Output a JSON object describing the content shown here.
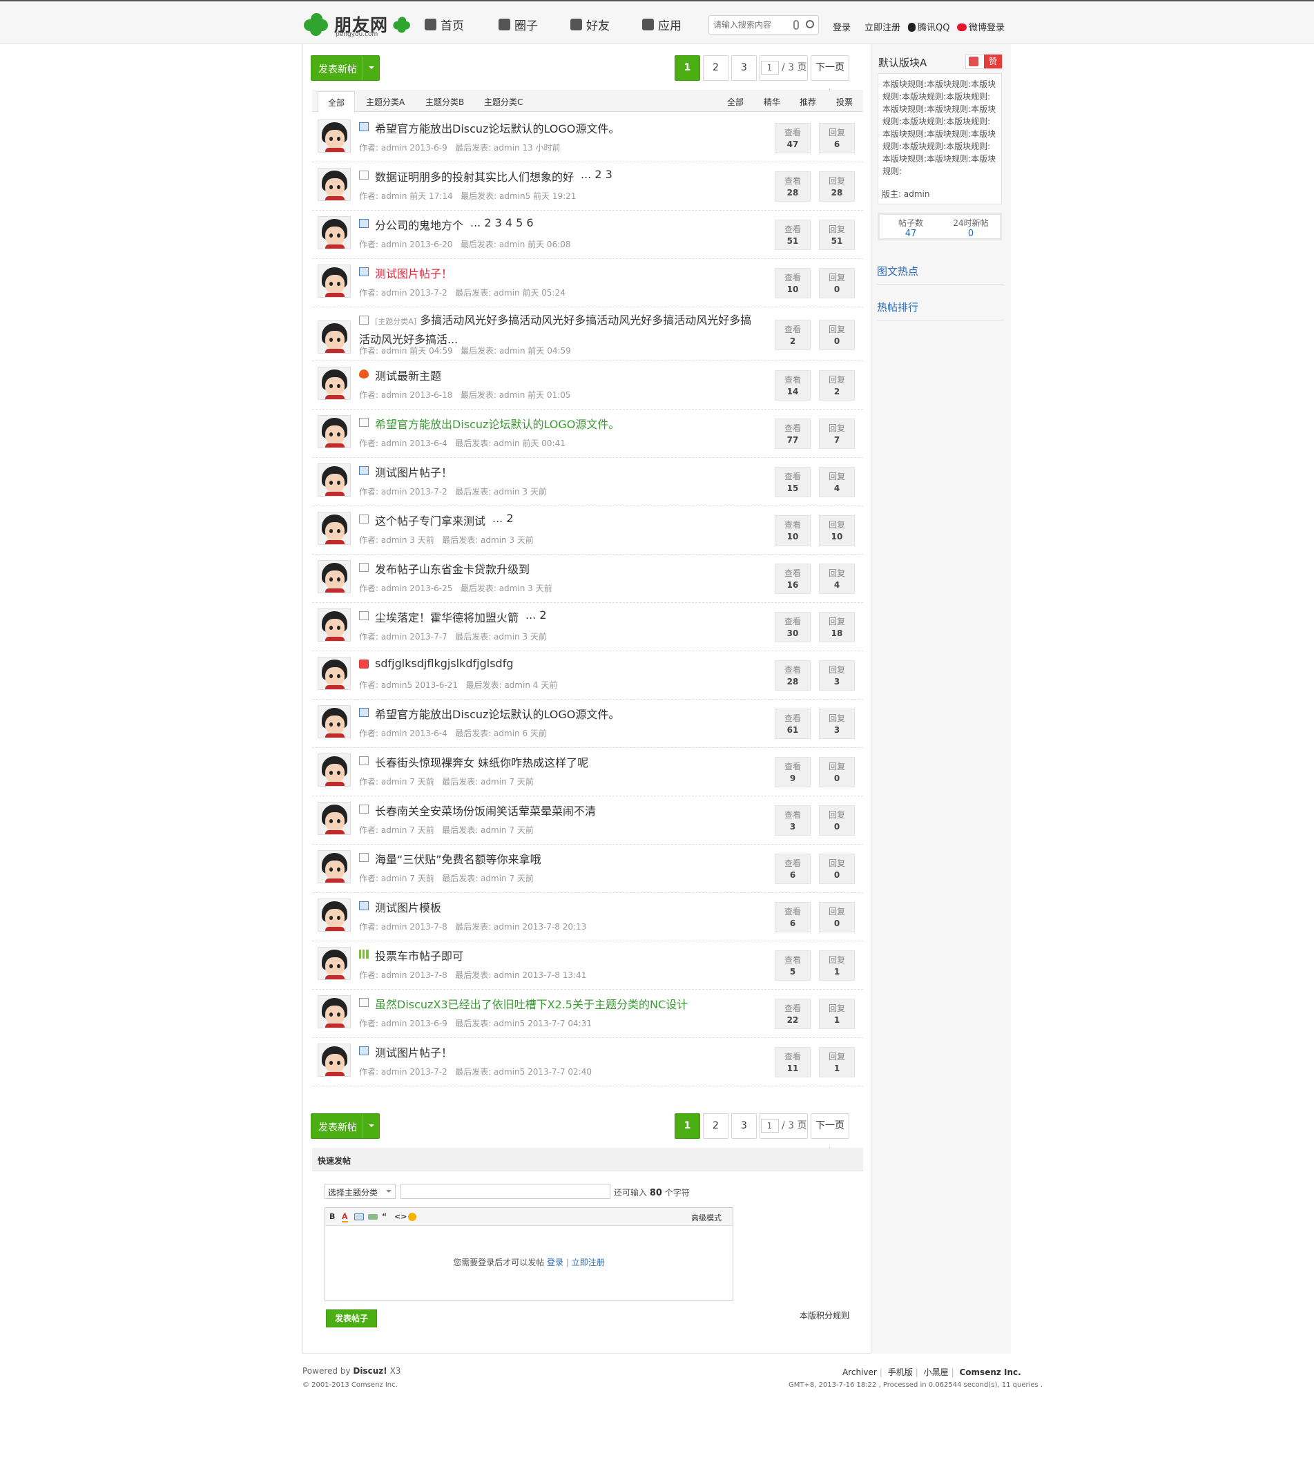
{
  "header": {
    "logo_text": "朋友网",
    "logo_sub": "pengyou.com",
    "nav": [
      "首页",
      "圈子",
      "好友",
      "应用"
    ],
    "search_placeholder": "请输入搜索内容",
    "links": [
      "登录",
      "立即注册",
      "腾讯QQ",
      "微博登录"
    ]
  },
  "toolbar": {
    "post_button": "发表新帖",
    "pages": [
      "1",
      "2",
      "3"
    ],
    "page_input": "1",
    "page_total": "/ 3 页",
    "next": "下一页"
  },
  "filters": {
    "left": [
      "全部",
      "主题分类A",
      "主题分类B",
      "主题分类C"
    ],
    "right": [
      "全部",
      "精华",
      "推荐",
      "投票"
    ]
  },
  "count_labels": {
    "views": "查看",
    "replies": "回复"
  },
  "threads": [
    {
      "icon": "image-icon",
      "title": "希望官方能放出Discuz论坛默认的LOGO源文件。",
      "pages": "",
      "color": "",
      "author": "作者: admin 2013-6-9",
      "last": "最后发表: admin 13 小时前",
      "views": "47",
      "replies": "6"
    },
    {
      "icon": "document-icon",
      "title": "数据证明朋多的投射其实比人们想象的好",
      "pages": "... 2  3",
      "color": "",
      "author": "作者: admin 前天 17:14",
      "last": "最后发表: admin5 前天 19:21",
      "views": "28",
      "replies": "28"
    },
    {
      "icon": "image-icon",
      "title": "分公司的鬼地方个",
      "pages": "... 2  3  4  5  6",
      "color": "",
      "author": "作者: admin 2013-6-20",
      "last": "最后发表: admin 前天 06:08",
      "views": "51",
      "replies": "51"
    },
    {
      "icon": "image-icon",
      "title": "测试图片帖子！",
      "pages": "",
      "color": "red",
      "author": "作者: admin 2013-7-2",
      "last": "最后发表: admin 前天 05:24",
      "views": "10",
      "replies": "0"
    },
    {
      "icon": "document-icon",
      "prefix": "[主题分类A]",
      "title": "多搞活动风光好多搞活动风光好多搞活动风光好多搞活动风光好多搞活动风光好多搞活...",
      "pages": "",
      "color": "",
      "author": "作者: admin 前天 04:59",
      "last": "最后发表: admin 前天 04:59",
      "views": "2",
      "replies": "0"
    },
    {
      "icon": "hot-icon",
      "title": "测试最新主题",
      "pages": "",
      "color": "",
      "author": "作者: admin 2013-6-18",
      "last": "最后发表: admin 前天 01:05",
      "views": "14",
      "replies": "2"
    },
    {
      "icon": "document-icon",
      "title": "希望官方能放出Discuz论坛默认的LOGO源文件。",
      "pages": "",
      "color": "green",
      "author": "作者: admin 2013-6-4",
      "last": "最后发表: admin 前天 00:41",
      "views": "77",
      "replies": "7"
    },
    {
      "icon": "image-icon",
      "title": "测试图片帖子！",
      "pages": "",
      "color": "",
      "author": "作者: admin 2013-7-2",
      "last": "最后发表: admin 3 天前",
      "views": "15",
      "replies": "4"
    },
    {
      "icon": "document-icon",
      "title": "这个帖子专门拿来测试",
      "pages": "... 2",
      "color": "",
      "author": "作者: admin 3 天前",
      "last": "最后发表: admin 3 天前",
      "views": "10",
      "replies": "10"
    },
    {
      "icon": "document-icon",
      "title": "发布帖子山东省金卡贷款升级到",
      "pages": "",
      "color": "",
      "author": "作者: admin 2013-6-25",
      "last": "最后发表: admin 3 天前",
      "views": "16",
      "replies": "4"
    },
    {
      "icon": "document-icon",
      "title": "尘埃落定！霍华德将加盟火箭",
      "pages": "... 2",
      "color": "",
      "author": "作者: admin 2013-7-7",
      "last": "最后发表: admin 3 天前",
      "views": "30",
      "replies": "18"
    },
    {
      "icon": "lock-icon",
      "title": "sdfjglksdjflkgjslkdfjglsdfg",
      "pages": "",
      "color": "",
      "author": "作者: admin5 2013-6-21",
      "last": "最后发表: admin 4 天前",
      "views": "28",
      "replies": "3"
    },
    {
      "icon": "image-icon",
      "title": "希望官方能放出Discuz论坛默认的LOGO源文件。",
      "pages": "",
      "color": "",
      "author": "作者: admin 2013-6-4",
      "last": "最后发表: admin 6 天前",
      "views": "61",
      "replies": "3"
    },
    {
      "icon": "document-icon",
      "title": "长春街头惊现裸奔女 妹纸你咋热成这样了呢",
      "pages": "",
      "color": "",
      "author": "作者: admin 7 天前",
      "last": "最后发表: admin 7 天前",
      "views": "9",
      "replies": "0"
    },
    {
      "icon": "document-icon",
      "title": "长春南关全安菜场份饭闹笑话荤菜晕菜闹不清",
      "pages": "",
      "color": "",
      "author": "作者: admin 7 天前",
      "last": "最后发表: admin 7 天前",
      "views": "3",
      "replies": "0"
    },
    {
      "icon": "document-icon",
      "title": "海量“三伏贴”免费名额等你来拿哦",
      "pages": "",
      "color": "",
      "author": "作者: admin 7 天前",
      "last": "最后发表: admin 7 天前",
      "views": "6",
      "replies": "0"
    },
    {
      "icon": "image-icon",
      "title": "测试图片模板",
      "pages": "",
      "color": "",
      "author": "作者: admin 2013-7-8",
      "last": "最后发表: admin 2013-7-8 20:13",
      "views": "6",
      "replies": "0"
    },
    {
      "icon": "poll-icon",
      "title": "投票车市帖子即可",
      "pages": "",
      "color": "",
      "author": "作者: admin 2013-7-8",
      "last": "最后发表: admin 2013-7-8 13:41",
      "views": "5",
      "replies": "1"
    },
    {
      "icon": "document-icon",
      "title": "虽然DiscuzX3已经出了依旧吐槽下X2.5关于主题分类的NC设计",
      "pages": "",
      "color": "green",
      "author": "作者: admin 2013-6-9",
      "last": "最后发表: admin5 2013-7-7 04:31",
      "views": "22",
      "replies": "1"
    },
    {
      "icon": "image-icon",
      "title": "测试图片帖子！",
      "pages": "",
      "color": "",
      "author": "作者: admin 2013-7-2",
      "last": "最后发表: admin5 2013-7-7 02:40",
      "views": "11",
      "replies": "1"
    }
  ],
  "quick_post": {
    "heading": "快速发帖",
    "category_select": "选择主题分类",
    "hint_prefix": "还可输入",
    "hint_count": "80",
    "hint_suffix": "个字符",
    "tools": [
      "B",
      "A",
      "",
      "",
      "“",
      "<>",
      ""
    ],
    "advanced": "高级模式",
    "login_msg": "您需要登录后才可以发帖",
    "login": "登录",
    "sep": "|",
    "register": "立即注册",
    "submit": "发表帖子",
    "rules_link": "本版积分规则"
  },
  "sidebar": {
    "title": "默认版块A",
    "like": "赞",
    "rules": "本版块规则:本版块规则:本版块规则:本版块规则:本版块规则:本版块规则:本版块规则:本版块规则:本版块规则:本版块规则:本版块规则:本版块规则:本版块规则:本版块规则:本版块规则:本版块规则:本版块规则:本版块规则:",
    "owner": "版主: admin",
    "stats": [
      {
        "label": "帖子数",
        "value": "47"
      },
      {
        "label": "24时新帖",
        "value": "0"
      }
    ],
    "sections": [
      "图文热点",
      "热帖排行"
    ]
  },
  "footer": {
    "powered_prefix": "Powered by",
    "powered_brand": "Discuz!",
    "powered_version": "X3",
    "copyright": "© 2001-2013 Comsenz Inc.",
    "links": [
      "Archiver",
      "手机版",
      "小黑屋",
      "Comsenz Inc."
    ],
    "stats": "GMT+8, 2013-7-16 18:22 , Processed in 0.062544 second(s), 11 queries ."
  }
}
